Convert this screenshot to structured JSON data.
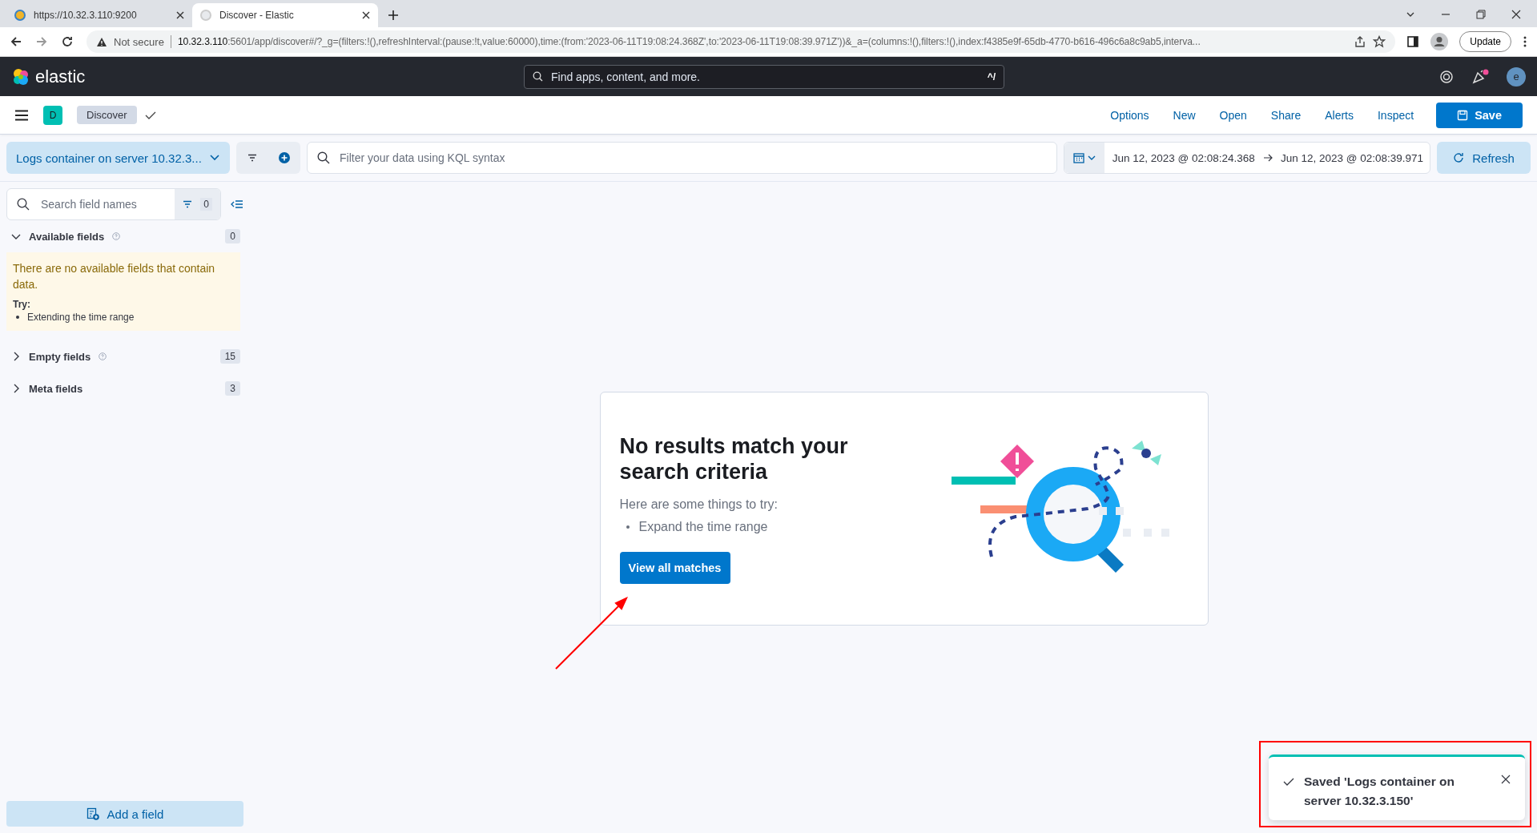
{
  "browser": {
    "tabs": [
      {
        "title": "https://10.32.3.110:9200",
        "selected": false
      },
      {
        "title": "Discover - Elastic",
        "selected": true
      }
    ],
    "address": {
      "security": "Not secure",
      "host": "10.32.3.110",
      "path": ":5601/app/discover#/?_g=(filters:!(),refreshInterval:(pause:!t,value:60000),time:(from:'2023-06-11T19:08:24.368Z',to:'2023-06-11T19:08:39.971Z'))&_a=(columns:!(),filters:!(),index:f4385e9f-65db-4770-b616-496c6a8c9ab5,interva..."
    },
    "update_button": "Update"
  },
  "header": {
    "logo": "elastic",
    "search_placeholder": "Find apps, content, and more.",
    "shortcut": "^/",
    "avatar": "e"
  },
  "toolbar": {
    "space": "D",
    "breadcrumb": "Discover",
    "menu": [
      "Options",
      "New",
      "Open",
      "Share",
      "Alerts",
      "Inspect"
    ],
    "save": "Save"
  },
  "query": {
    "data_view": "Logs container on server 10.32.3...",
    "placeholder": "Filter your data using KQL syntax",
    "start": "Jun 12, 2023 @ 02:08:24.368",
    "end": "Jun 12, 2023 @ 02:08:39.971",
    "refresh": "Refresh"
  },
  "sidebar": {
    "search_placeholder": "Search field names",
    "filter_count": "0",
    "groups": [
      {
        "label": "Available fields",
        "count": "0",
        "expanded": true,
        "info": true,
        "callout": {
          "message": "There are no available fields that contain data.",
          "try_label": "Try:",
          "suggestions": [
            "Extending the time range"
          ]
        }
      },
      {
        "label": "Empty fields",
        "count": "15",
        "expanded": false,
        "info": true
      },
      {
        "label": "Meta fields",
        "count": "3",
        "expanded": false,
        "info": false
      }
    ],
    "add_field": "Add a field"
  },
  "empty_state": {
    "title": "No results match your search criteria",
    "subtitle": "Here are some things to try:",
    "suggestions": [
      "Expand the time range"
    ],
    "button": "View all matches"
  },
  "toast": {
    "message": "Saved 'Logs container on server 10.32.3.150'"
  }
}
